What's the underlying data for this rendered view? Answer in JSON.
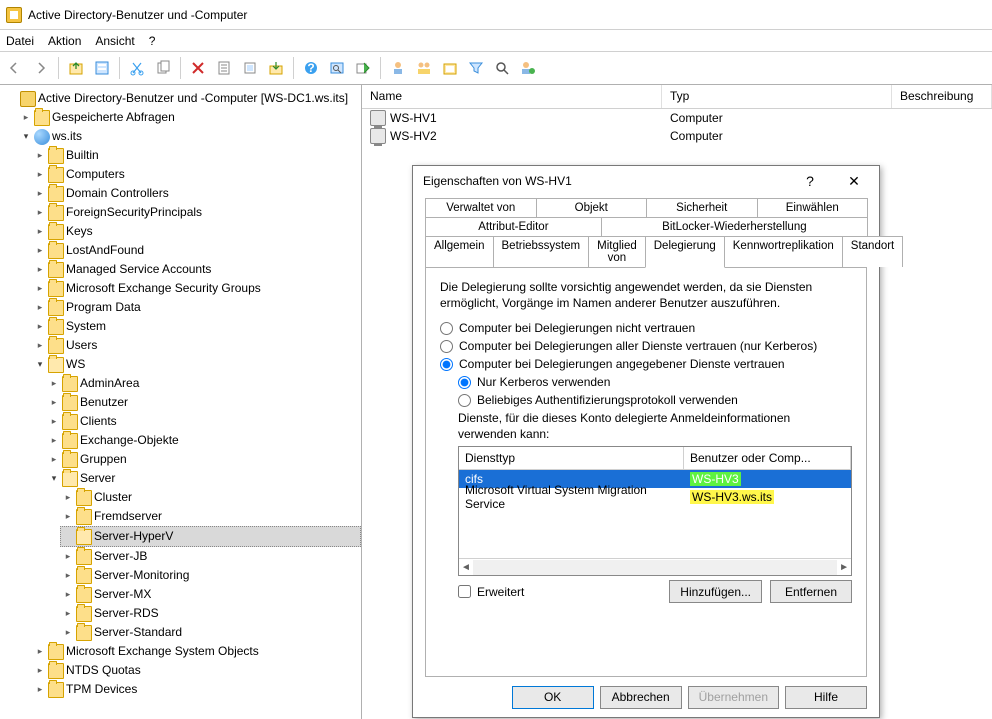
{
  "window": {
    "title": "Active Directory-Benutzer und -Computer"
  },
  "menu": {
    "file": "Datei",
    "action": "Aktion",
    "view": "Ansicht",
    "help": "?"
  },
  "tree": {
    "root": "Active Directory-Benutzer und -Computer [WS-DC1.ws.its]",
    "saved_queries": "Gespeicherte Abfragen",
    "domain": "ws.its",
    "builtin": "Builtin",
    "computers": "Computers",
    "domain_controllers": "Domain Controllers",
    "fsp": "ForeignSecurityPrincipals",
    "keys": "Keys",
    "laf": "LostAndFound",
    "msa": "Managed Service Accounts",
    "mesg": "Microsoft Exchange Security Groups",
    "program_data": "Program Data",
    "system": "System",
    "users": "Users",
    "ws": "WS",
    "adminarea": "AdminArea",
    "benutzer": "Benutzer",
    "clients": "Clients",
    "exchange_obj": "Exchange-Objekte",
    "gruppen": "Gruppen",
    "server": "Server",
    "cluster": "Cluster",
    "fremdserver": "Fremdserver",
    "server_hyperv": "Server-HyperV",
    "server_jb": "Server-JB",
    "server_mon": "Server-Monitoring",
    "server_mx": "Server-MX",
    "server_rds": "Server-RDS",
    "server_std": "Server-Standard",
    "meso": "Microsoft Exchange System Objects",
    "ntds_quotas": "NTDS Quotas",
    "tpm": "TPM Devices"
  },
  "list": {
    "headers": {
      "name": "Name",
      "type": "Typ",
      "desc": "Beschreibung"
    },
    "rows": [
      {
        "name": "WS-HV1",
        "type": "Computer"
      },
      {
        "name": "WS-HV2",
        "type": "Computer"
      }
    ]
  },
  "dialog": {
    "title": "Eigenschaften von WS-HV1",
    "tabs_row1": [
      "Verwaltet von",
      "Objekt",
      "Sicherheit",
      "Einwählen"
    ],
    "tabs_row2a": [
      "Attribut-Editor",
      "BitLocker-Wiederherstellung"
    ],
    "tabs_row3": [
      "Allgemein",
      "Betriebssystem",
      "Mitglied von",
      "Delegierung",
      "Kennwortreplikation",
      "Standort"
    ],
    "active_tab": "Delegierung",
    "note": "Die Delegierung sollte vorsichtig angewendet werden, da sie Diensten ermöglicht, Vorgänge im Namen anderer Benutzer auszuführen.",
    "opt_none": "Computer bei Delegierungen nicht vertrauen",
    "opt_any": "Computer bei Delegierungen aller Dienste vertrauen (nur Kerberos)",
    "opt_spec": "Computer bei Delegierungen angegebener Dienste vertrauen",
    "opt_kerb": "Nur Kerberos verwenden",
    "opt_anyp": "Beliebiges Authentifizierungsprotokoll verwenden",
    "svc_label": "Dienste, für die dieses Konto delegierte Anmeldeinformationen verwenden kann:",
    "svc_head1": "Diensttyp",
    "svc_head2": "Benutzer oder Comp...",
    "svc_rows": [
      {
        "type": "cifs",
        "target": "WS-HV3",
        "sel": true
      },
      {
        "type": "Microsoft Virtual System Migration Service",
        "target": "WS-HV3.ws.its",
        "sel": false
      }
    ],
    "expanded": "Erweitert",
    "add": "Hinzufügen...",
    "remove": "Entfernen",
    "ok": "OK",
    "cancel": "Abbrechen",
    "apply": "Übernehmen",
    "help": "Hilfe"
  }
}
